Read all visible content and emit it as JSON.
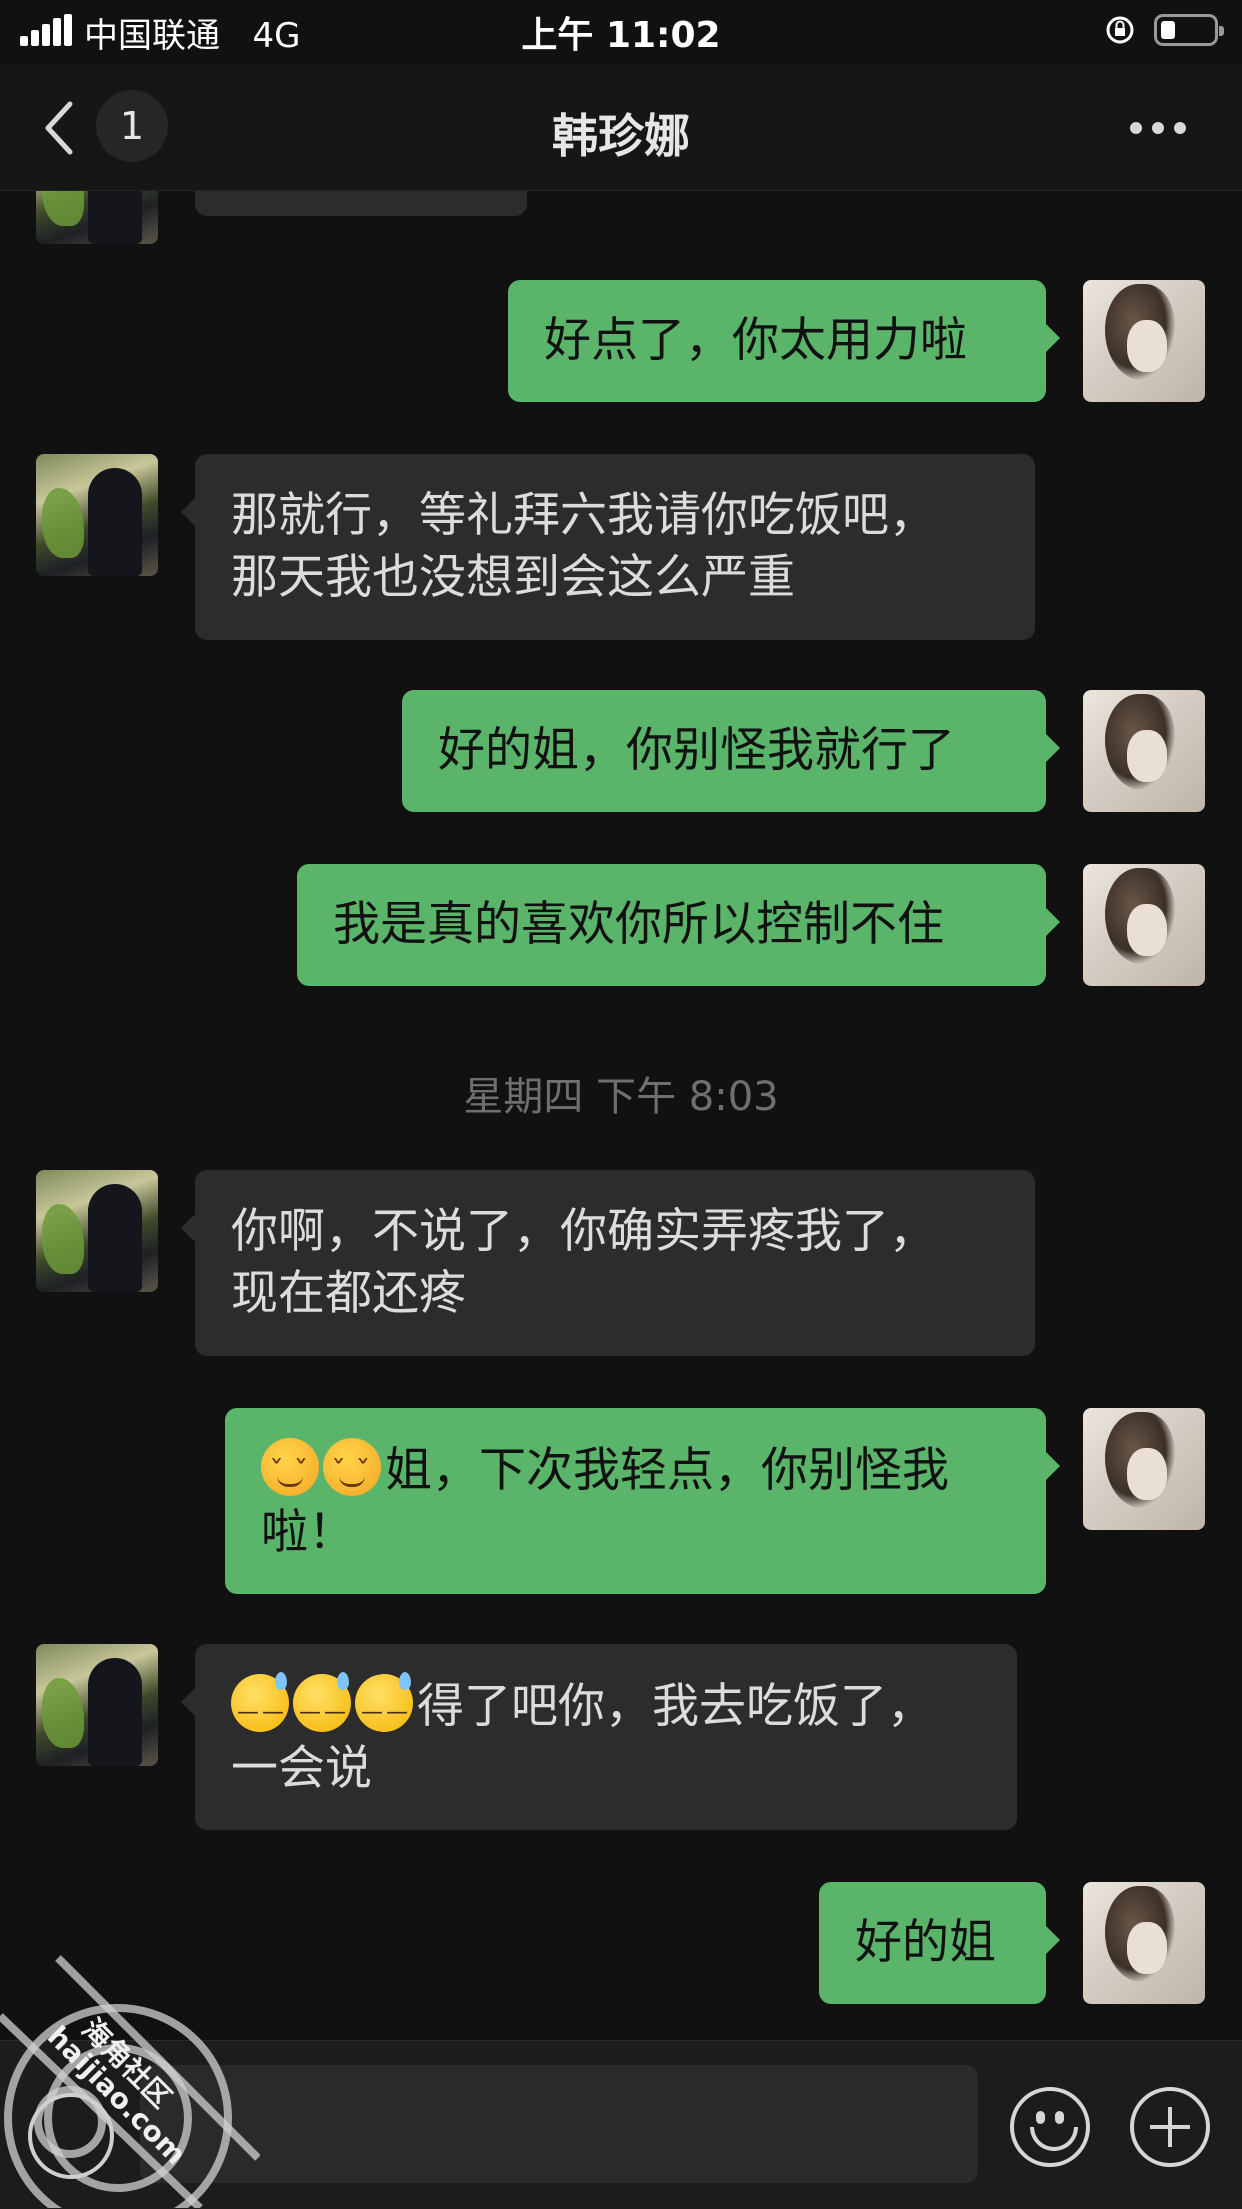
{
  "status_bar": {
    "carrier": "中国联通",
    "network": "4G",
    "time": "上午 11:02"
  },
  "nav": {
    "title": "韩珍娜",
    "unread_count": "1"
  },
  "messages": [
    {
      "side": "in",
      "text": ""
    },
    {
      "side": "out",
      "text": "好点了，你太用力啦"
    },
    {
      "side": "in",
      "text": "那就行，等礼拜六我请你吃饭吧，那天我也没想到会这么严重"
    },
    {
      "side": "out",
      "text": "好的姐，你别怪我就行了"
    },
    {
      "side": "out",
      "text": "我是真的喜欢你所以控制不住"
    },
    {
      "timestamp": "星期四 下午 8:03"
    },
    {
      "side": "in",
      "text": "你啊，不说了，你确实弄疼我了，现在都还疼"
    },
    {
      "side": "out",
      "emoji": [
        "shy-face",
        "shy-face"
      ],
      "text": "姐，下次我轻点，你别怪我啦！"
    },
    {
      "side": "in",
      "emoji": [
        "sweat-smile-face",
        "sweat-smile-face",
        "sweat-smile-face"
      ],
      "text": "得了吧你，我去吃饭了，一会说"
    },
    {
      "side": "out",
      "text": "好的姐"
    }
  ],
  "msg": {
    "m1": "好点了，你太用力啦",
    "m2a": "那就行，等礼拜六我请你吃饭吧，",
    "m2b": "那天我也没想到会这么严重",
    "m3": "好的姐，你别怪我就行了",
    "m4": "我是真的喜欢你所以控制不住",
    "ts": "星期四 下午 8:03",
    "m5a": "你啊，不说了，你确实弄疼我了，",
    "m5b": "现在都还疼",
    "m6a": "姐，下次我轻点，你别怪我",
    "m6b": "啦！",
    "m7a": "得了吧你，我去吃饭了，",
    "m7b": "一会说",
    "m8": "好的姐"
  },
  "watermark": {
    "name": "海角社区",
    "url": "haijiao.com"
  },
  "colors": {
    "background": "#111111",
    "outgoing_bubble": "#5ab56a",
    "incoming_bubble": "#2c2c2c",
    "nav_bar": "#161616"
  }
}
